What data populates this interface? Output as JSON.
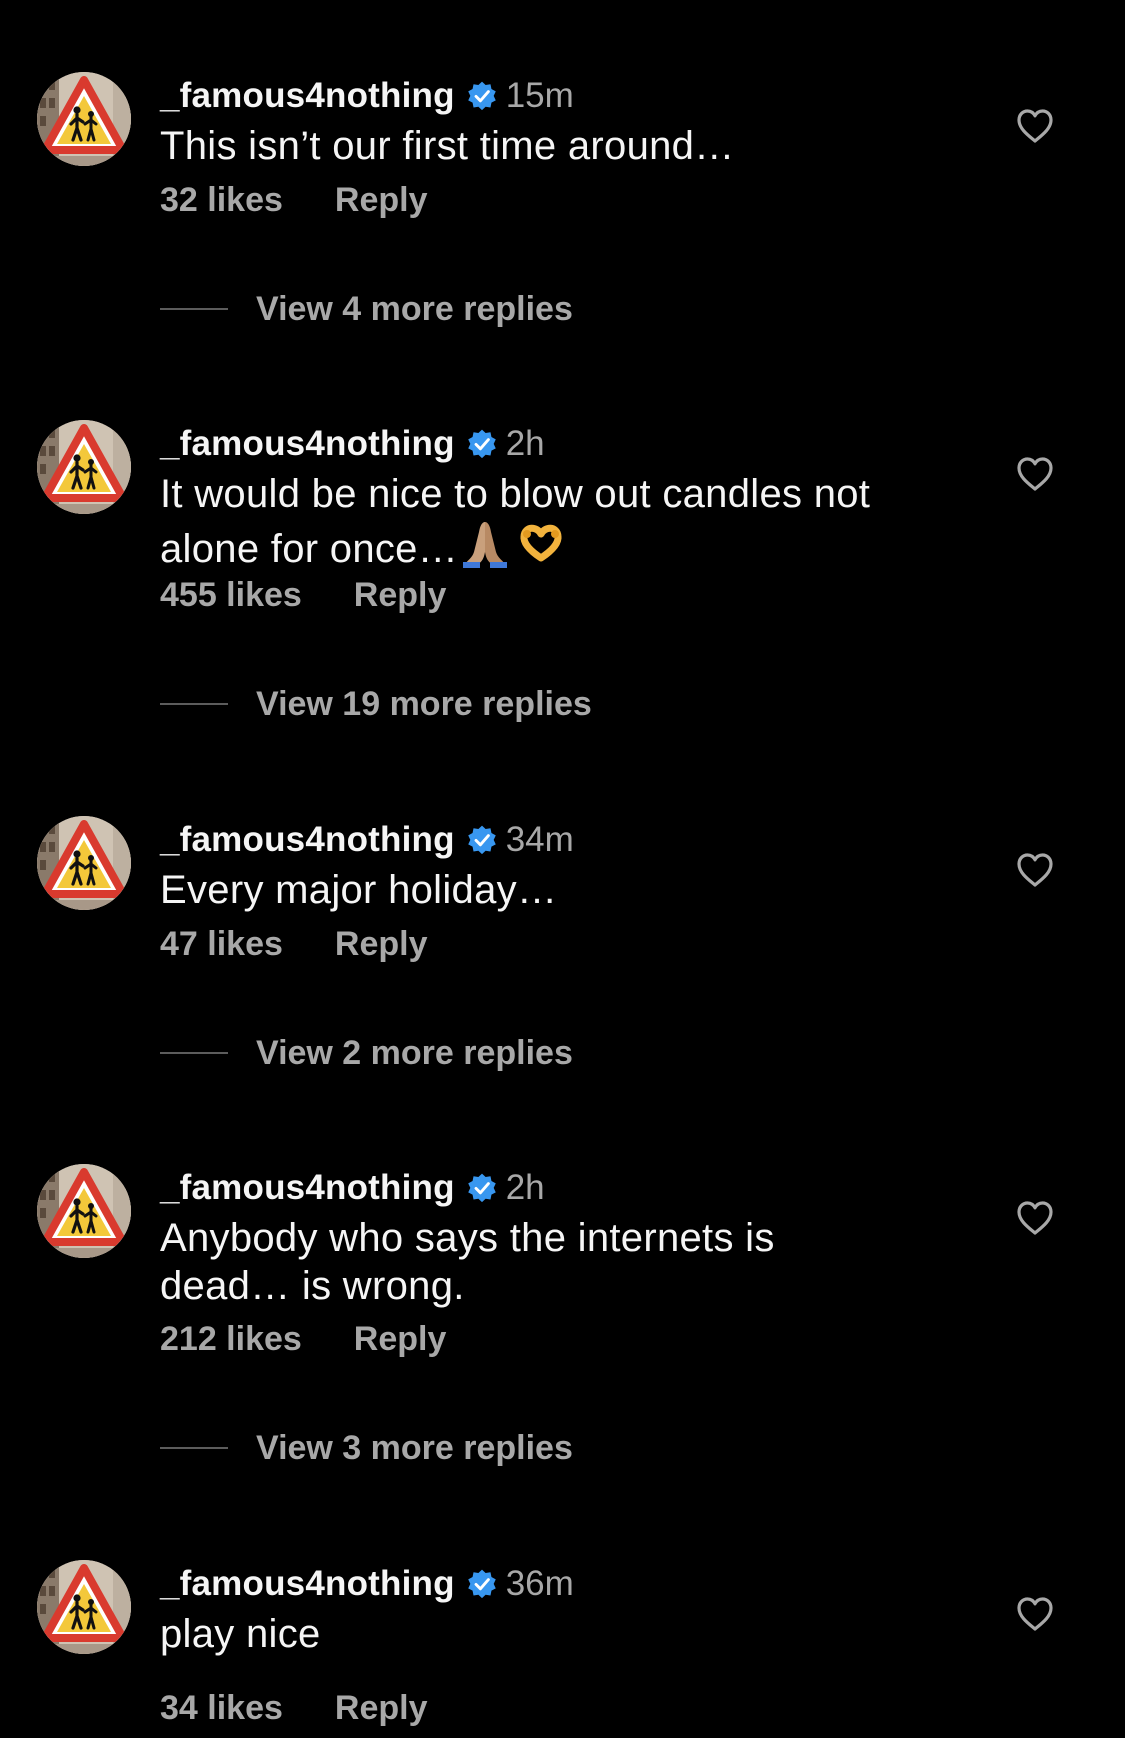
{
  "comments": [
    {
      "username": "_famous4nothing",
      "time": "15m",
      "text": "This isn’t our first time around…",
      "emojis": [],
      "likes": "32 likes",
      "reply_label": "Reply",
      "view_replies": "View 4 more replies"
    },
    {
      "username": "_famous4nothing",
      "time": "2h",
      "text": "It would be nice to blow out candles not alone for once…",
      "emojis": [
        "folded-hands-emoji",
        "heart-hands-emoji"
      ],
      "likes": "455 likes",
      "reply_label": "Reply",
      "view_replies": "View 19 more replies"
    },
    {
      "username": "_famous4nothing",
      "time": "34m",
      "text": "Every major holiday…",
      "emojis": [],
      "likes": "47 likes",
      "reply_label": "Reply",
      "view_replies": "View 2 more replies"
    },
    {
      "username": "_famous4nothing",
      "time": "2h",
      "text": "Anybody who says the internets is dead… is wrong.",
      "emojis": [],
      "likes": "212 likes",
      "reply_label": "Reply",
      "view_replies": "View 3 more replies"
    },
    {
      "username": "_famous4nothing",
      "time": "36m",
      "text": "play nice",
      "emojis": [],
      "likes": "34 likes",
      "reply_label": "Reply"
    }
  ],
  "icons": {
    "verified": "verified-badge-icon",
    "like": "heart-outline-icon",
    "avatar": "pedestrian-warning-sign-avatar"
  },
  "colors": {
    "background": "#000000",
    "primary_text": "#f5f5f5",
    "secondary_text": "#a8a8a8",
    "verified_blue": "#3897f0",
    "divider": "#5c5c5c"
  }
}
